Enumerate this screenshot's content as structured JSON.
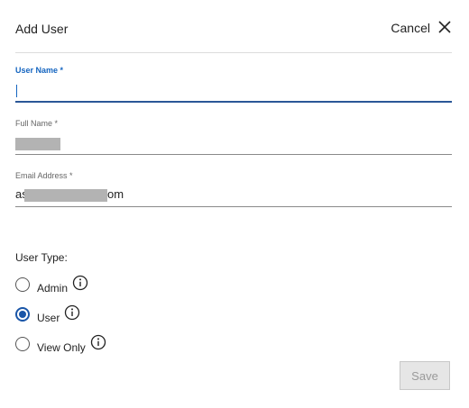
{
  "dialog": {
    "title": "Add User",
    "cancel_label": "Cancel"
  },
  "fields": {
    "user_name": {
      "label": "User Name *",
      "value": ""
    },
    "full_name": {
      "label": "Full Name *",
      "value": "[redacted]"
    },
    "email": {
      "label": "Email Address *",
      "prefix": "as",
      "suffix": "om"
    }
  },
  "user_type": {
    "label": "User Type:",
    "options": [
      {
        "label": "Admin",
        "selected": false,
        "icon": "info-icon"
      },
      {
        "label": "User",
        "selected": true,
        "icon": "info-icon"
      },
      {
        "label": "View Only",
        "selected": false,
        "icon": "info-icon"
      }
    ]
  },
  "actions": {
    "save_label": "Save",
    "save_enabled": false
  },
  "colors": {
    "accent": "#1a56a8",
    "active_label": "#1565c0",
    "disabled_button_bg": "#e6e6e6",
    "disabled_button_text": "#9a9a9a"
  }
}
